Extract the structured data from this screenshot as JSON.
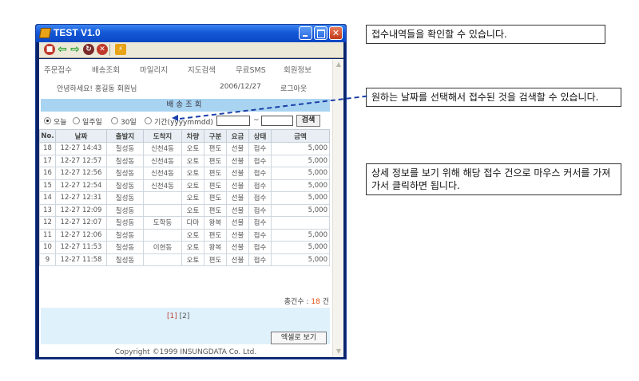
{
  "window": {
    "title": "TEST V1.0"
  },
  "menu": [
    "주문접수",
    "배송조회",
    "마일리지",
    "지도검색",
    "무료SMS",
    "회원정보"
  ],
  "greeting": {
    "text": "안녕하세요! 홍길동 회원님",
    "date": "2006/12/27",
    "logout": "로그아웃"
  },
  "section_title": "배송조회",
  "filter": {
    "options": [
      "오늘",
      "일주일",
      "30일",
      "기간(yyyymmdd)"
    ],
    "selected": "오늘",
    "range_sep": "~",
    "search_label": "검색"
  },
  "table": {
    "headers": [
      "No.",
      "날짜",
      "출발지",
      "도착지",
      "차량",
      "구분",
      "요금",
      "상태",
      "금액"
    ],
    "rows": [
      [
        "18",
        "12-27 14:43",
        "칠성동",
        "신천4동",
        "오토",
        "편도",
        "선불",
        "접수",
        "5,000"
      ],
      [
        "17",
        "12-27 12:57",
        "칠성동",
        "신천4동",
        "오토",
        "편도",
        "선불",
        "접수",
        "5,000"
      ],
      [
        "16",
        "12-27 12:56",
        "칠성동",
        "신천4동",
        "오토",
        "편도",
        "선불",
        "접수",
        "5,000"
      ],
      [
        "15",
        "12-27 12:54",
        "칠성동",
        "신천4동",
        "오토",
        "편도",
        "선불",
        "접수",
        "5,000"
      ],
      [
        "14",
        "12-27 12:31",
        "칠성동",
        "",
        "오토",
        "편도",
        "선불",
        "접수",
        "5,000"
      ],
      [
        "13",
        "12-27 12:09",
        "칠성동",
        "",
        "오토",
        "편도",
        "선불",
        "접수",
        "5,000"
      ],
      [
        "12",
        "12-27 12:07",
        "칠성동",
        "도학동",
        "다마",
        "왕복",
        "선불",
        "접수",
        ""
      ],
      [
        "11",
        "12-27 12:06",
        "칠성동",
        "",
        "오토",
        "편도",
        "선불",
        "접수",
        "5,000"
      ],
      [
        "10",
        "12-27 11:53",
        "칠성동",
        "이현동",
        "오토",
        "왕복",
        "선불",
        "접수",
        "5,000"
      ],
      [
        "9",
        "12-27 11:58",
        "칠성동",
        "",
        "오토",
        "편도",
        "선불",
        "접수",
        "5,000"
      ]
    ]
  },
  "total": {
    "label": "총건수 :",
    "count": "18",
    "unit": "건"
  },
  "pager": {
    "current": "[1]",
    "other": "[2]"
  },
  "excel_label": "엑셀로 보기",
  "copyright": "Copyright ©1999 INSUNGDATA Co. Ltd.",
  "callouts": {
    "c1": "접수내역들을 확인할 수 있습니다.",
    "c2": "원하는 날짜를 선택해서 접수된 것을 검색할 수 있습니다.",
    "c3": "상세 정보를 보기 위해 해당 접수 건으로 마우스 커서를 가져가서 클릭하면 됩니다."
  },
  "colors": {
    "titlebar": "#1458d6",
    "section": "#a9d4f1",
    "pager_band": "#dff1fb",
    "accent": "#e05010",
    "callout_line": "#1a3fa8"
  }
}
